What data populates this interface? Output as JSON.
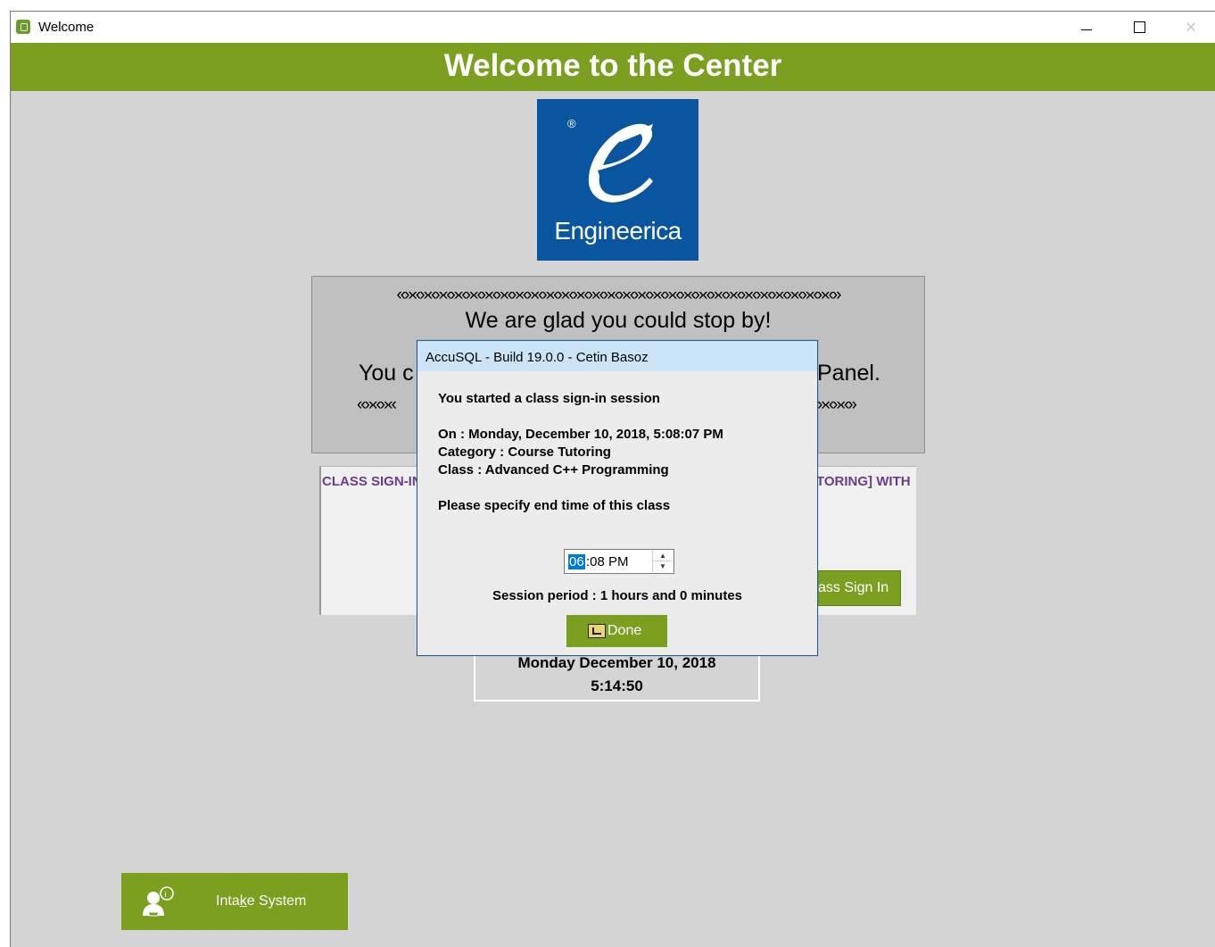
{
  "window": {
    "title": "Welcome",
    "controls": {
      "minimize": "—",
      "maximize": "□",
      "close": "✕"
    }
  },
  "header": {
    "title": "Welcome to the Center"
  },
  "logo": {
    "registered": "®",
    "brand": "Engineerica"
  },
  "welcome_panel": {
    "decoration": "«»«»«»«»«»«»«»«»«»«»«»«»«»«»«»«»«»«»«»«»«»«»«»«»«»«»«»«»«»",
    "headline": "We are glad you could stop by!",
    "instruction_left": "You c",
    "instruction_right": "Panel.",
    "decoration_left": "«»«»«",
    "decoration_right": "»«»«»"
  },
  "class_panel": {
    "label_left": "CLASS SIGN-IN",
    "label_right": "TORING] WITH",
    "sign_in_button": "ass Sign  In"
  },
  "clock": {
    "date": "Monday December 10, 2018",
    "time": "5:14:50"
  },
  "intake": {
    "label_pre": "Inta",
    "label_key": "k",
    "label_post": "e System"
  },
  "dialog": {
    "title": "AccuSQL - Build 19.0.0 - Cetin Basoz",
    "started": "You started a class sign-in session",
    "on": "On : Monday, December 10, 2018, 5:08:07 PM",
    "category": "Category : Course Tutoring",
    "class": "Class : Advanced C++ Programming",
    "prompt": "Please specify end time of this class",
    "time_hour": "06",
    "time_rest": ":08 PM",
    "session_period": "Session period : 1 hours and 0 minutes",
    "done_label": "Done"
  },
  "colors": {
    "accent_green": "#7b9f1e",
    "logo_blue": "#0a55a0",
    "class_label_purple": "#6a3c8c",
    "dialog_title_bg": "#cce4f7"
  }
}
